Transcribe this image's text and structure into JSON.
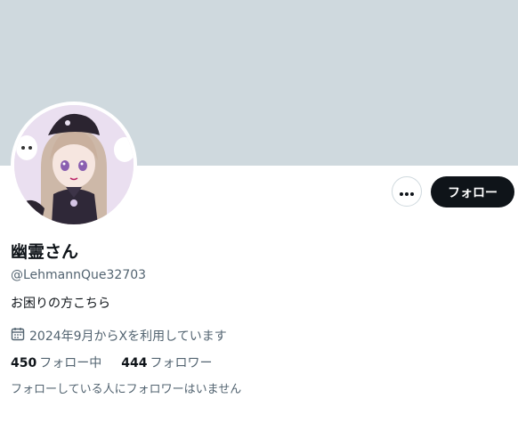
{
  "profile": {
    "display_name": "幽霊さん",
    "handle": "@LehmannQue32703",
    "bio": "お困りの方こちら",
    "joined": "2024年9月からXを利用しています"
  },
  "actions": {
    "more_icon": "more-horizontal-icon",
    "follow_label": "フォロー"
  },
  "stats": {
    "following_count": "450",
    "following_label": "フォロー中",
    "followers_count": "444",
    "followers_label": "フォロワー"
  },
  "followers_note": "フォローしている人にフォロワーはいません",
  "colors": {
    "banner": "#cfd9de",
    "text_primary": "#0f1419",
    "text_secondary": "#536471",
    "button_dark": "#0f1419"
  }
}
